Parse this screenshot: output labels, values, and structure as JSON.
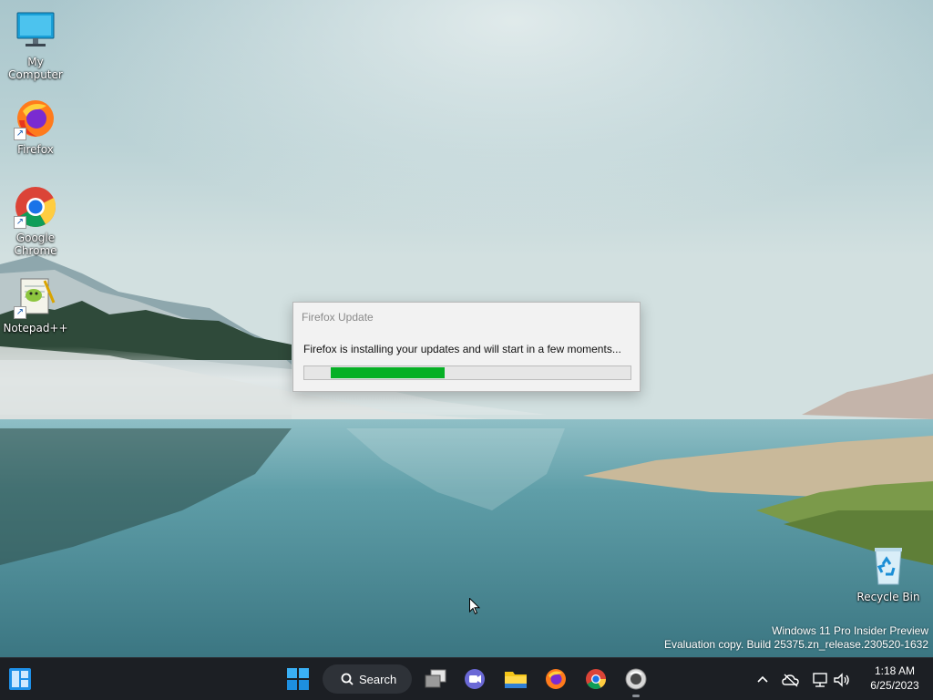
{
  "desktop": {
    "icons": [
      {
        "label": "My Computer",
        "icon": "computer-icon"
      },
      {
        "label": "Firefox",
        "icon": "firefox-icon"
      },
      {
        "label": "Google Chrome",
        "icon": "chrome-icon"
      },
      {
        "label": "Notepad++",
        "icon": "notepadpp-icon"
      },
      {
        "label": "Recycle Bin",
        "icon": "recycle-bin-icon"
      }
    ]
  },
  "dialog": {
    "title": "Firefox Update",
    "message": "Firefox is installing your updates and will start in a few moments...",
    "progress": {
      "start_fraction": 0.08,
      "end_fraction": 0.43,
      "color": "#06b025"
    }
  },
  "watermark": {
    "line1": "Windows 11 Pro Insider Preview",
    "line2": "Evaluation copy. Build 25375.zn_release.230520-1632"
  },
  "taskbar": {
    "search_label": "Search",
    "apps": [
      "start-icon",
      "search-icon",
      "task-view-icon",
      "chat-icon",
      "file-explorer-icon",
      "firefox-icon",
      "chrome-icon",
      "firefox-updater-icon"
    ],
    "tray": [
      "chevron-up-icon",
      "onedrive-offline-icon",
      "network-icon",
      "volume-icon"
    ],
    "time": "1:18 AM",
    "date": "6/25/2023"
  }
}
